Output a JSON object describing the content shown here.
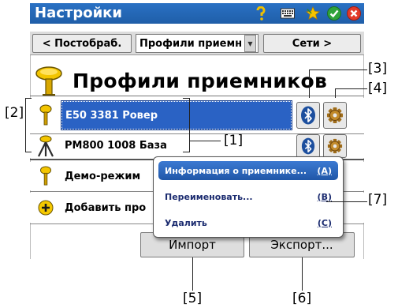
{
  "app": {
    "title": "Настройки"
  },
  "navbar": {
    "back_label": "< Постобраб.",
    "dropdown_value": "Профили приемн",
    "next_label": "Сети >"
  },
  "heading": "Профили приемников",
  "receivers": [
    {
      "name": "E50 3381 Ровер",
      "selected": true
    },
    {
      "name": "PM800 1008 База",
      "selected": false
    }
  ],
  "extra_items": [
    {
      "label": "Демо-режим"
    },
    {
      "label": "Добавить про"
    }
  ],
  "footer": {
    "import_label": "Импорт",
    "export_label": "Экспорт..."
  },
  "context_menu": {
    "items": [
      {
        "label": "Информация о приемнике...",
        "shortcut": "(A)",
        "selected": true
      },
      {
        "label": "Переименовать...",
        "shortcut": "(B)",
        "selected": false
      },
      {
        "label": "Удалить",
        "shortcut": "(C)",
        "selected": false
      }
    ]
  },
  "callouts": [
    "[1]",
    "[2]",
    "[3]",
    "[4]",
    "[5]",
    "[6]",
    "[7]"
  ],
  "colors": {
    "titlebar": "#2366b6",
    "selection": "#2a62c4",
    "menu_text": "#1c2c70"
  }
}
